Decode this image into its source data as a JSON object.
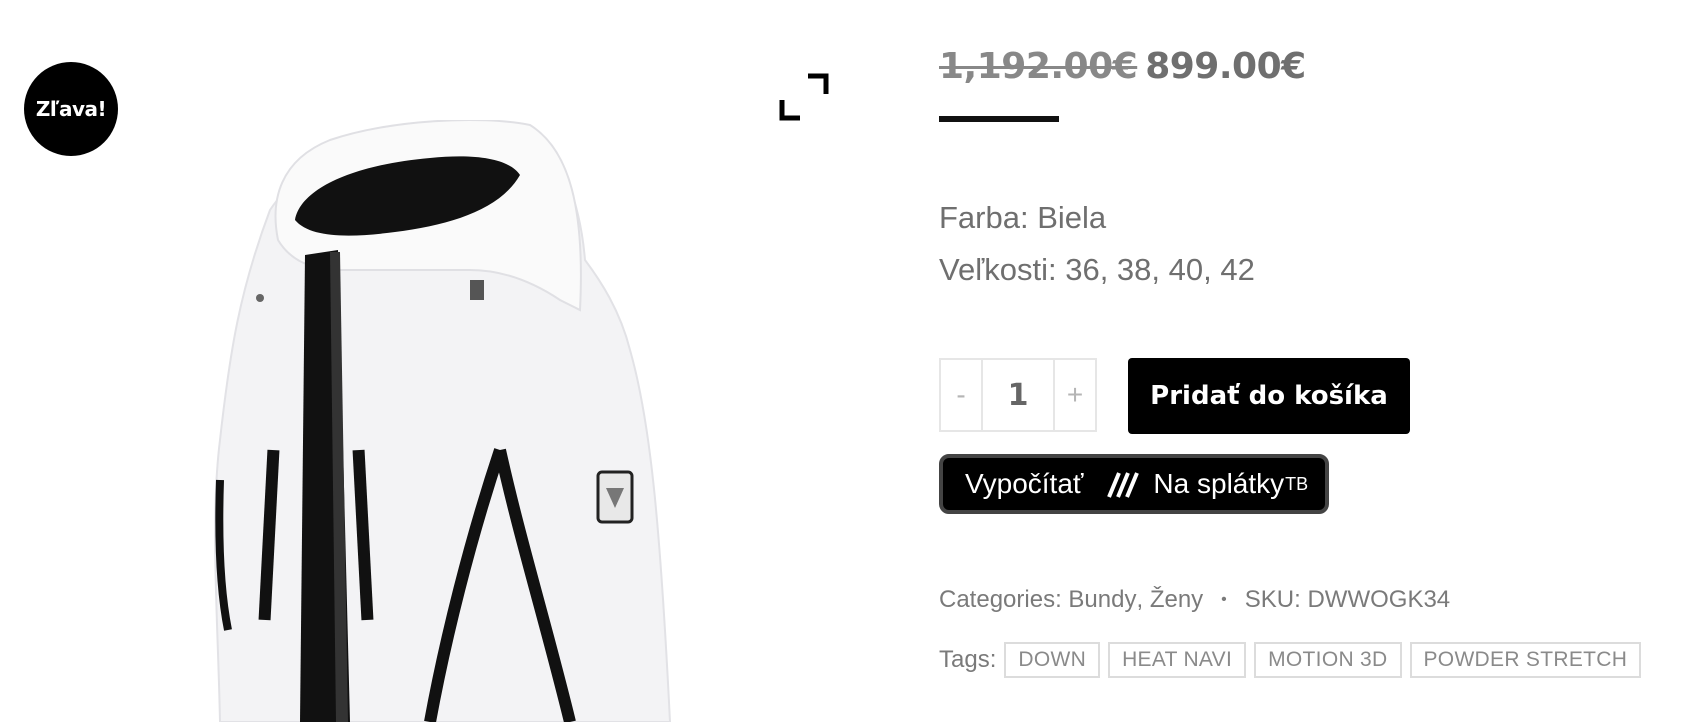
{
  "gallery": {
    "sale_badge": "Zľava!",
    "zoom_icon": "fullscreen-icon"
  },
  "product": {
    "price_old": "1,192.00€",
    "price_new": "899.00€",
    "color_line": "Farba: Biela",
    "sizes_line": "Veľkosti: 36, 38, 40, 42"
  },
  "cart": {
    "minus": "-",
    "quantity": "1",
    "plus": "+",
    "add_label": "Pridať do košíka"
  },
  "installment": {
    "calc_label": "Vypočítať",
    "na_splatky": "Na splátky",
    "tb": "TB"
  },
  "meta": {
    "categories_label": "Categories:",
    "cat1": "Bundy",
    "cat2": "Ženy",
    "sku_label": "SKU:",
    "sku": "DWWOGK34",
    "tags_label": "Tags:",
    "tags": [
      "DOWN",
      "HEAT NAVI",
      "MOTION 3D",
      "POWDER STRETCH"
    ]
  }
}
